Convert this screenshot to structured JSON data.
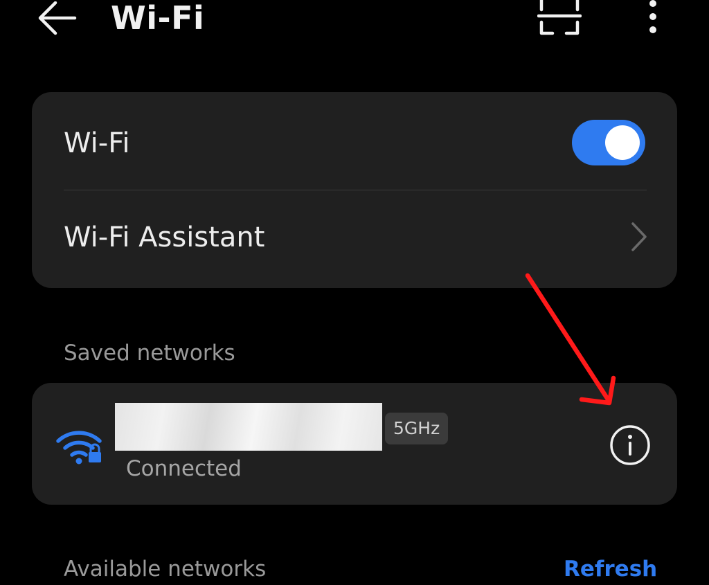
{
  "header": {
    "title": "Wi-Fi",
    "icons": {
      "back": "back-arrow-icon",
      "scan": "scan-qr-icon",
      "more": "more-vertical-icon"
    }
  },
  "wifi_card": {
    "wifi_label": "Wi-Fi",
    "wifi_enabled": true,
    "assistant_label": "Wi-Fi Assistant"
  },
  "saved": {
    "section_label": "Saved networks",
    "network": {
      "band": "5GHz",
      "status": "Connected",
      "icon": "wifi-locked-icon",
      "info_icon": "info-icon"
    }
  },
  "available": {
    "section_label": "Available networks",
    "refresh_label": "Refresh"
  },
  "colors": {
    "background": "#000000",
    "card": "#202020",
    "accent": "#2f7bf0",
    "annotation": "#ff1a1a"
  }
}
